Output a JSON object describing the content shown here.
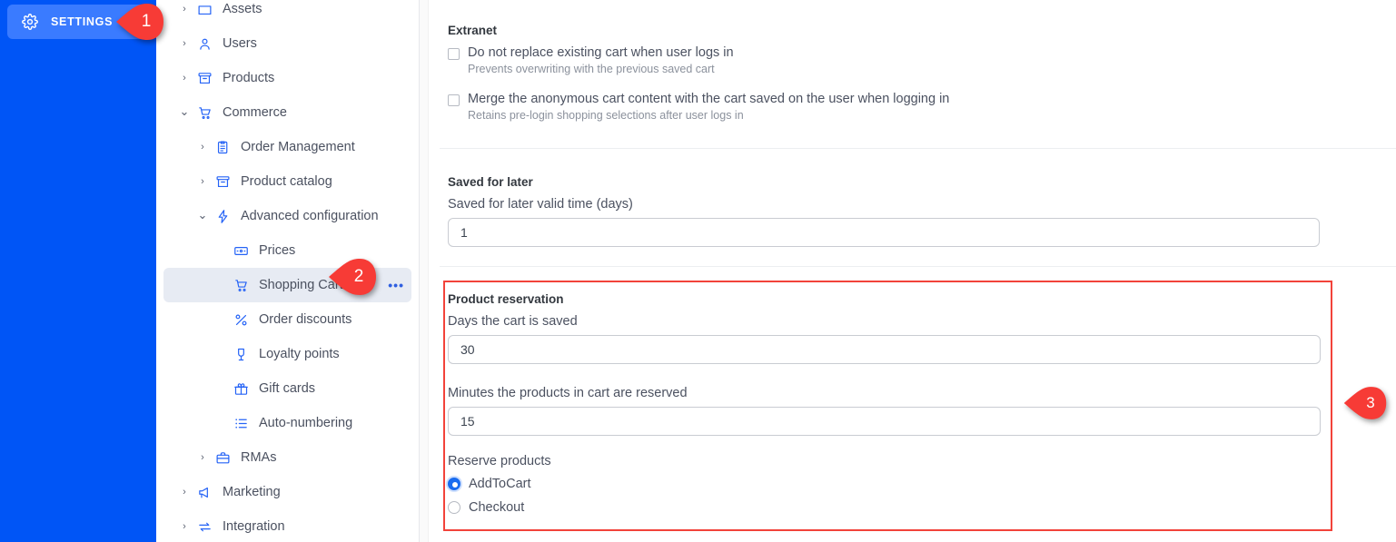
{
  "rail": {
    "settings_label": "SETTINGS",
    "settings_icon": "gear-icon",
    "background_color": "#0055f6",
    "button_color": "#3a7bff"
  },
  "tree": {
    "items": [
      {
        "label": "Assets",
        "icon": "folder-icon",
        "chevron": "right",
        "indent": 0,
        "selected": false,
        "cutoff": true
      },
      {
        "label": "Users",
        "icon": "user-icon",
        "chevron": "right",
        "indent": 0,
        "selected": false
      },
      {
        "label": "Products",
        "icon": "box-icon",
        "chevron": "right",
        "indent": 0,
        "selected": false
      },
      {
        "label": "Commerce",
        "icon": "cart-icon",
        "chevron": "down",
        "indent": 0,
        "selected": false
      },
      {
        "label": "Order Management",
        "icon": "clipboard-icon",
        "chevron": "right",
        "indent": 1,
        "selected": false
      },
      {
        "label": "Product catalog",
        "icon": "box-icon",
        "chevron": "right",
        "indent": 1,
        "selected": false
      },
      {
        "label": "Advanced configuration",
        "icon": "lightning-icon",
        "chevron": "down",
        "indent": 1,
        "selected": false
      },
      {
        "label": "Prices",
        "icon": "price-tag-icon",
        "chevron": "none",
        "indent": 2,
        "selected": false
      },
      {
        "label": "Shopping Cart",
        "icon": "cart-icon",
        "chevron": "none",
        "indent": 2,
        "selected": true,
        "overflow_menu": "•••"
      },
      {
        "label": "Order discounts",
        "icon": "percent-icon",
        "chevron": "none",
        "indent": 2,
        "selected": false
      },
      {
        "label": "Loyalty points",
        "icon": "loyalty-badge-icon",
        "chevron": "none",
        "indent": 2,
        "selected": false
      },
      {
        "label": "Gift cards",
        "icon": "gift-icon",
        "chevron": "none",
        "indent": 2,
        "selected": false
      },
      {
        "label": "Auto-numbering",
        "icon": "list-icon",
        "chevron": "none",
        "indent": 2,
        "selected": false
      },
      {
        "label": "RMAs",
        "icon": "briefcase-icon",
        "chevron": "right",
        "indent": 1,
        "selected": false
      },
      {
        "label": "Marketing",
        "icon": "megaphone-icon",
        "chevron": "right",
        "indent": 0,
        "selected": false
      },
      {
        "label": "Integration",
        "icon": "exchange-icon",
        "chevron": "right",
        "indent": 0,
        "selected": false
      }
    ]
  },
  "main": {
    "extranet": {
      "title": "Extranet",
      "checkbox_1": {
        "label": "Do not replace existing cart when user logs in",
        "help": "Prevents overwriting with the previous saved cart",
        "checked": false
      },
      "checkbox_2": {
        "label": "Merge the anonymous cart content with the cart saved on the user when logging in",
        "help": "Retains pre-login shopping selections after user logs in",
        "checked": false
      }
    },
    "saved_for_later": {
      "title": "Saved for later",
      "field_label": "Saved for later valid time (days)",
      "value": "1"
    },
    "product_reservation": {
      "title": "Product reservation",
      "days_label": "Days the cart is saved",
      "days_value": "30",
      "minutes_label": "Minutes the products in cart are reserved",
      "minutes_value": "15",
      "reserve_label": "Reserve products",
      "options": [
        {
          "label": "AddToCart",
          "selected": true
        },
        {
          "label": "Checkout",
          "selected": false
        }
      ],
      "highlight_color": "#f2433a"
    }
  },
  "markers": [
    {
      "id": "1",
      "label": "1",
      "color": "#f73b36"
    },
    {
      "id": "2",
      "label": "2",
      "color": "#f73b36"
    },
    {
      "id": "3",
      "label": "3",
      "color": "#f73b36"
    }
  ]
}
